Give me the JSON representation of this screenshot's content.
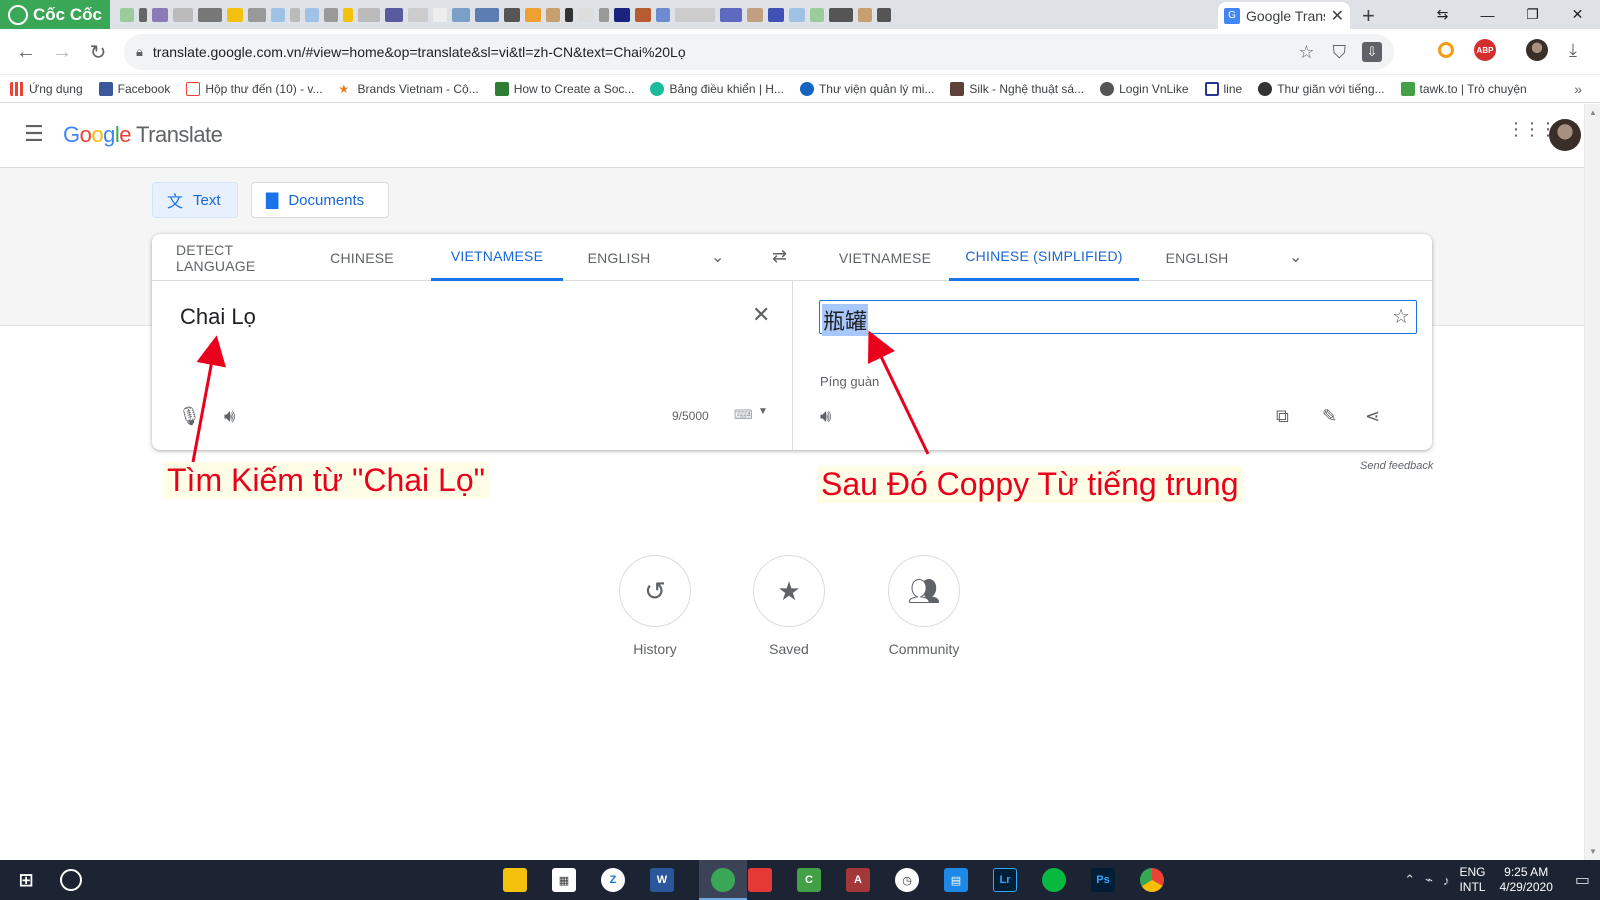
{
  "browser": {
    "brand": "Cốc Cốc",
    "active_tab_title": "Google Trans",
    "url": "translate.google.com.vn/#view=home&op=translate&sl=vi&tl=zh-CN&text=Chai%20Lọ",
    "bookmarks": [
      {
        "label": "Ứng dụng",
        "color": "#4285f4"
      },
      {
        "label": "Facebook",
        "color": "#3b5998"
      },
      {
        "label": "Hộp thư đến (10) - v...",
        "color": "#ea4335"
      },
      {
        "label": "Brands Vietnam - Cộ...",
        "color": "#e67e22"
      },
      {
        "label": "How to Create a Soc...",
        "color": "#2e7d32"
      },
      {
        "label": "Bảng điều khiển | H...",
        "color": "#1abc9c"
      },
      {
        "label": "Thư viện quản lý mi...",
        "color": "#1565c0"
      },
      {
        "label": "Silk - Nghệ thuật sá...",
        "color": "#5d4037"
      },
      {
        "label": "Login VnLike",
        "color": "#555555"
      },
      {
        "label": "line",
        "color": "#283593"
      },
      {
        "label": "Thư giãn với tiếng...",
        "color": "#333333"
      },
      {
        "label": "tawk.to | Trò chuyện",
        "color": "#43a047"
      }
    ]
  },
  "app": {
    "logo_text": "Google",
    "product": "Translate",
    "modes": {
      "text": "Text",
      "documents": "Documents"
    },
    "source_langs": [
      "DETECT LANGUAGE",
      "CHINESE",
      "VIETNAMESE",
      "ENGLISH"
    ],
    "target_langs": [
      "VIETNAMESE",
      "CHINESE (SIMPLIFIED)",
      "ENGLISH"
    ],
    "source_text": "Chai Lọ",
    "char_count": "9/5000",
    "translation": "瓶罐",
    "pinyin": "Píng guàn",
    "send_feedback": "Send feedback",
    "shortcuts": [
      {
        "label": "History",
        "icon": "history-icon"
      },
      {
        "label": "Saved",
        "icon": "star-icon"
      },
      {
        "label": "Community",
        "icon": "community-icon"
      }
    ]
  },
  "annotations": {
    "left": "Tìm Kiếm từ \"Chai Lọ\"",
    "right": "Sau Đó Coppy Từ tiếng trung",
    "color": "#e8001c"
  },
  "taskbar": {
    "lang_line1": "ENG",
    "lang_line2": "INTL",
    "time": "9:25 AM",
    "date": "4/29/2020"
  }
}
